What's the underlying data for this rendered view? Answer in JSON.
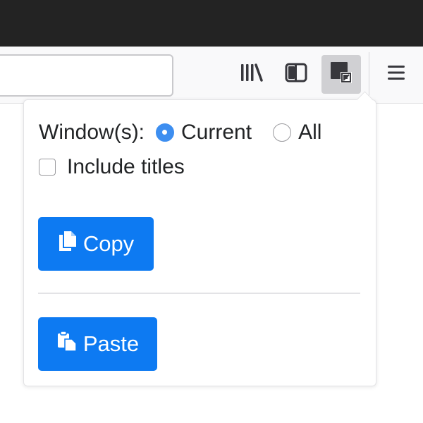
{
  "toolbar": {
    "icons": [
      "library-icon",
      "sidebar-icon",
      "extension-icon",
      "hamburger-menu-icon"
    ]
  },
  "popup": {
    "windows_label": "Window(s):",
    "options": [
      {
        "label": "Current",
        "checked": true
      },
      {
        "label": "All",
        "checked": false
      }
    ],
    "include_titles_label": "Include titles",
    "include_titles_checked": false,
    "copy_label": "Copy",
    "paste_label": "Paste"
  },
  "colors": {
    "titlebar": "#232323",
    "toolbar": "#f9f9fa",
    "button_primary": "#0d7af2",
    "radio_checked": "#3d8ef0"
  }
}
